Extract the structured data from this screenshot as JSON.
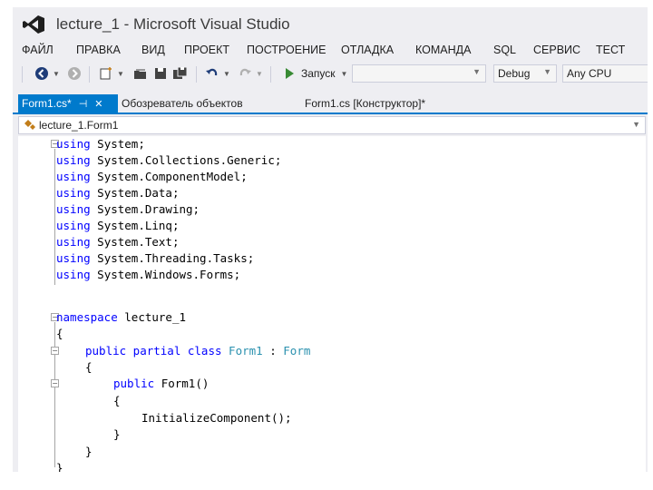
{
  "window": {
    "title": "lecture_1 - Microsoft Visual Studio"
  },
  "menu": [
    "ФАЙЛ",
    "ПРАВКА",
    "ВИД",
    "ПРОЕКТ",
    "ПОСТРОЕНИЕ",
    "ОТЛАДКА",
    "КОМАНДА",
    "SQL",
    "СЕРВИС",
    "ТЕСТ"
  ],
  "toolbar": {
    "start_label": "Запуск",
    "config_value": "Debug",
    "platform_value": "Any CPU"
  },
  "tabs": {
    "active_label": "Form1.cs*",
    "pin_glyph": "⊣",
    "close_glyph": "✕",
    "object_browser": "Обозреватель объектов",
    "designer": "Form1.cs [Конструктор]*"
  },
  "navbar": {
    "class_path": "lecture_1.Form1"
  },
  "code": {
    "usings": [
      [
        "using",
        "System;"
      ],
      [
        "using",
        "System.Collections.Generic;"
      ],
      [
        "using",
        "System.ComponentModel;"
      ],
      [
        "using",
        "System.Data;"
      ],
      [
        "using",
        "System.Drawing;"
      ],
      [
        "using",
        "System.Linq;"
      ],
      [
        "using",
        "System.Text;"
      ],
      [
        "using",
        "System.Threading.Tasks;"
      ],
      [
        "using",
        "System.Windows.Forms;"
      ]
    ],
    "ns_keyword": "namespace",
    "ns_name": "lecture_1",
    "open_brace": "{",
    "close_brace": "}",
    "class_mods": "public partial class",
    "class_name": "Form1",
    "class_sep": " : ",
    "base_class": "Form",
    "ctor_mod": "public",
    "ctor_name": "Form1()",
    "call": "InitializeComponent();"
  },
  "colors": {
    "accent": "#007acc",
    "keyword": "#0000ff",
    "type": "#2b91af",
    "run": "#388a34"
  },
  "icons": [
    "visual-studio-logo",
    "back-icon",
    "forward-icon",
    "new-project-icon",
    "open-file-icon",
    "save-icon",
    "save-all-icon",
    "undo-icon",
    "redo-icon",
    "start-icon",
    "class-icon",
    "fold-toggle-icon"
  ]
}
